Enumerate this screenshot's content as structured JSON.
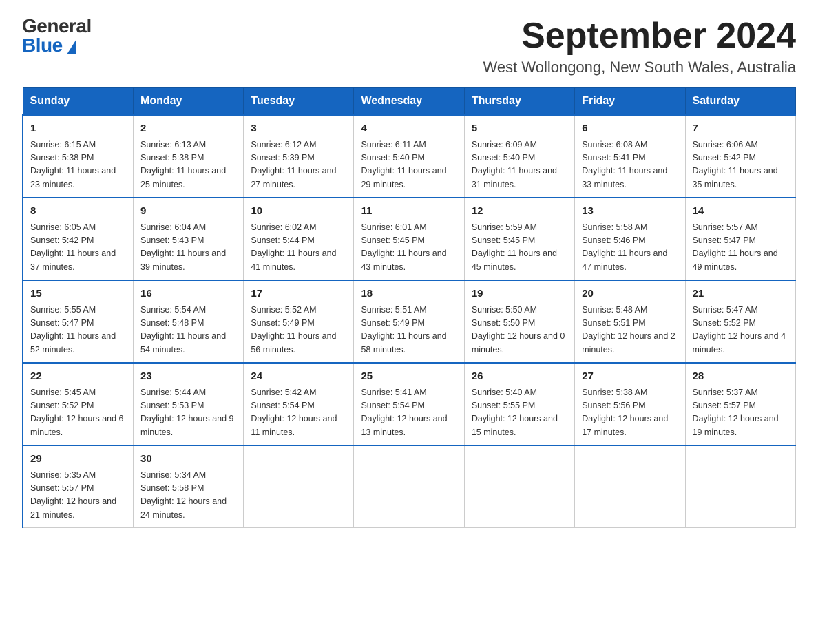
{
  "logo": {
    "general": "General",
    "blue": "Blue"
  },
  "title": "September 2024",
  "location": "West Wollongong, New South Wales, Australia",
  "days_of_week": [
    "Sunday",
    "Monday",
    "Tuesday",
    "Wednesday",
    "Thursday",
    "Friday",
    "Saturday"
  ],
  "weeks": [
    [
      {
        "day": "1",
        "sunrise": "6:15 AM",
        "sunset": "5:38 PM",
        "daylight": "11 hours and 23 minutes."
      },
      {
        "day": "2",
        "sunrise": "6:13 AM",
        "sunset": "5:38 PM",
        "daylight": "11 hours and 25 minutes."
      },
      {
        "day": "3",
        "sunrise": "6:12 AM",
        "sunset": "5:39 PM",
        "daylight": "11 hours and 27 minutes."
      },
      {
        "day": "4",
        "sunrise": "6:11 AM",
        "sunset": "5:40 PM",
        "daylight": "11 hours and 29 minutes."
      },
      {
        "day": "5",
        "sunrise": "6:09 AM",
        "sunset": "5:40 PM",
        "daylight": "11 hours and 31 minutes."
      },
      {
        "day": "6",
        "sunrise": "6:08 AM",
        "sunset": "5:41 PM",
        "daylight": "11 hours and 33 minutes."
      },
      {
        "day": "7",
        "sunrise": "6:06 AM",
        "sunset": "5:42 PM",
        "daylight": "11 hours and 35 minutes."
      }
    ],
    [
      {
        "day": "8",
        "sunrise": "6:05 AM",
        "sunset": "5:42 PM",
        "daylight": "11 hours and 37 minutes."
      },
      {
        "day": "9",
        "sunrise": "6:04 AM",
        "sunset": "5:43 PM",
        "daylight": "11 hours and 39 minutes."
      },
      {
        "day": "10",
        "sunrise": "6:02 AM",
        "sunset": "5:44 PM",
        "daylight": "11 hours and 41 minutes."
      },
      {
        "day": "11",
        "sunrise": "6:01 AM",
        "sunset": "5:45 PM",
        "daylight": "11 hours and 43 minutes."
      },
      {
        "day": "12",
        "sunrise": "5:59 AM",
        "sunset": "5:45 PM",
        "daylight": "11 hours and 45 minutes."
      },
      {
        "day": "13",
        "sunrise": "5:58 AM",
        "sunset": "5:46 PM",
        "daylight": "11 hours and 47 minutes."
      },
      {
        "day": "14",
        "sunrise": "5:57 AM",
        "sunset": "5:47 PM",
        "daylight": "11 hours and 49 minutes."
      }
    ],
    [
      {
        "day": "15",
        "sunrise": "5:55 AM",
        "sunset": "5:47 PM",
        "daylight": "11 hours and 52 minutes."
      },
      {
        "day": "16",
        "sunrise": "5:54 AM",
        "sunset": "5:48 PM",
        "daylight": "11 hours and 54 minutes."
      },
      {
        "day": "17",
        "sunrise": "5:52 AM",
        "sunset": "5:49 PM",
        "daylight": "11 hours and 56 minutes."
      },
      {
        "day": "18",
        "sunrise": "5:51 AM",
        "sunset": "5:49 PM",
        "daylight": "11 hours and 58 minutes."
      },
      {
        "day": "19",
        "sunrise": "5:50 AM",
        "sunset": "5:50 PM",
        "daylight": "12 hours and 0 minutes."
      },
      {
        "day": "20",
        "sunrise": "5:48 AM",
        "sunset": "5:51 PM",
        "daylight": "12 hours and 2 minutes."
      },
      {
        "day": "21",
        "sunrise": "5:47 AM",
        "sunset": "5:52 PM",
        "daylight": "12 hours and 4 minutes."
      }
    ],
    [
      {
        "day": "22",
        "sunrise": "5:45 AM",
        "sunset": "5:52 PM",
        "daylight": "12 hours and 6 minutes."
      },
      {
        "day": "23",
        "sunrise": "5:44 AM",
        "sunset": "5:53 PM",
        "daylight": "12 hours and 9 minutes."
      },
      {
        "day": "24",
        "sunrise": "5:42 AM",
        "sunset": "5:54 PM",
        "daylight": "12 hours and 11 minutes."
      },
      {
        "day": "25",
        "sunrise": "5:41 AM",
        "sunset": "5:54 PM",
        "daylight": "12 hours and 13 minutes."
      },
      {
        "day": "26",
        "sunrise": "5:40 AM",
        "sunset": "5:55 PM",
        "daylight": "12 hours and 15 minutes."
      },
      {
        "day": "27",
        "sunrise": "5:38 AM",
        "sunset": "5:56 PM",
        "daylight": "12 hours and 17 minutes."
      },
      {
        "day": "28",
        "sunrise": "5:37 AM",
        "sunset": "5:57 PM",
        "daylight": "12 hours and 19 minutes."
      }
    ],
    [
      {
        "day": "29",
        "sunrise": "5:35 AM",
        "sunset": "5:57 PM",
        "daylight": "12 hours and 21 minutes."
      },
      {
        "day": "30",
        "sunrise": "5:34 AM",
        "sunset": "5:58 PM",
        "daylight": "12 hours and 24 minutes."
      },
      null,
      null,
      null,
      null,
      null
    ]
  ]
}
